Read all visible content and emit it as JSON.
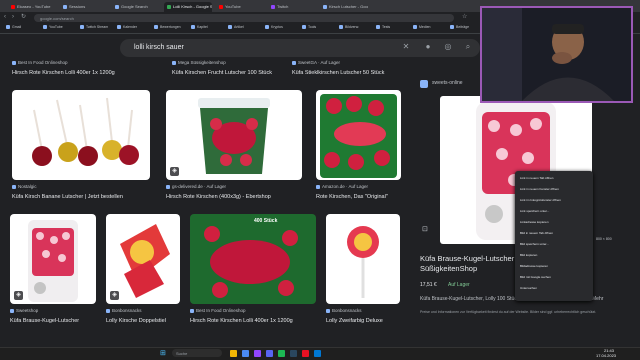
{
  "browser": {
    "tabs": [
      {
        "title": "Elcaseo - YouTube",
        "color": "#ff0000"
      },
      {
        "title": "Sessions",
        "color": "#8ab4f8"
      },
      {
        "title": "Google Search",
        "color": "#8ab4f8"
      },
      {
        "title": "Lolli Kirsch - Google Suche",
        "color": "#34a853"
      },
      {
        "title": "YouTube",
        "color": "#ff0000"
      },
      {
        "title": "Twitch",
        "color": "#9146ff"
      },
      {
        "title": "Kirsch Lutscher - Google",
        "color": "#8ab4f8"
      }
    ],
    "url": "google.com/search",
    "bookmarks": [
      "Gmail",
      "YouTube",
      "Twitch Stream",
      "Kalender",
      "Bewertungen",
      "Kapitel",
      "Artikel",
      "Kryptos",
      "Tools",
      "Bildverw.",
      "Tests",
      "Medien",
      "Beiträge",
      "Stats",
      "Steam",
      "Discord",
      "Mehr"
    ]
  },
  "search": {
    "query": "lolli kirsch sauer"
  },
  "results": {
    "row0": [
      {
        "source": "Best In Food Onlineshop",
        "title": "Hirsch Rote Kirschen Lolli 400er 1x 1200g"
      },
      {
        "source": "Mega Süssigkeitenshop",
        "title": "Küfa Kirschen Frucht Lutscher 100 Stück"
      },
      {
        "source": "SweetGA · Auf Lager",
        "title": "Küfa Stieklkirschen Lutscher 50 Stück"
      }
    ],
    "row1": [
      {
        "source": "Nostalgic",
        "title": "Küfa Kirsch Banane Lutscher | Jetzt bestellen"
      },
      {
        "source": "gs-delivered.de · Auf Lager",
        "title": "Hirsch Rote Kirschen (400x3g) - Ebertshop"
      },
      {
        "source": "Amazon.de · Auf Lager",
        "title": "Rote Kirschen, Das \"Original\""
      }
    ],
    "row2": [
      {
        "source": "Sweetshop",
        "title": "Küfa Brause-Kugel-Lutscher"
      },
      {
        "source": "Bonbonsnacks",
        "title": "Lolly Kirsche Doppelstiel"
      },
      {
        "source": "Best In Food Onlineshop",
        "title": "Hirsch Rote Kirschen Lolli 400er 1x 1200g"
      },
      {
        "source": "Bonbonsnacks",
        "title": "Lolly Zweifarbig Deluxe"
      }
    ],
    "badge_label": "400 Stück"
  },
  "preview": {
    "site": "sweets-online",
    "title": "Küfa Brause-Kugel-Lutscher Lolly, 100 Stück | SüßigkeitenShop",
    "price": "17,51 €",
    "availability": "Auf Lager",
    "link_text": "Küfa Brause-Kugel-Lutscher, Lolly 100 Stück",
    "note": "Preise und Informationen zur Verfügbarkeit findest du auf der Website. Bilder sind ggf. urheberrechtlich geschützt.",
    "more": "Mehr",
    "size": "800 × 800"
  },
  "context_menu": {
    "items": [
      "Link in neuem Tab öffnen",
      "Link in neuem Fenster öffnen",
      "Link im Inkognitofenster öffnen",
      "Link speichern unter...",
      "Linkadresse kopieren",
      "Bild in neuem Tab öffnen",
      "Bild speichern unter...",
      "Bild kopieren",
      "Bildadresse kopieren",
      "Bild mit Google suchen",
      "Untersuchen"
    ]
  },
  "taskbar": {
    "search_placeholder": "Suche",
    "time": "21:43",
    "date": "17.04.2023"
  },
  "colors": {
    "bg": "#202124",
    "accent": "#8ab4f8",
    "cherry": "#c0173a"
  }
}
